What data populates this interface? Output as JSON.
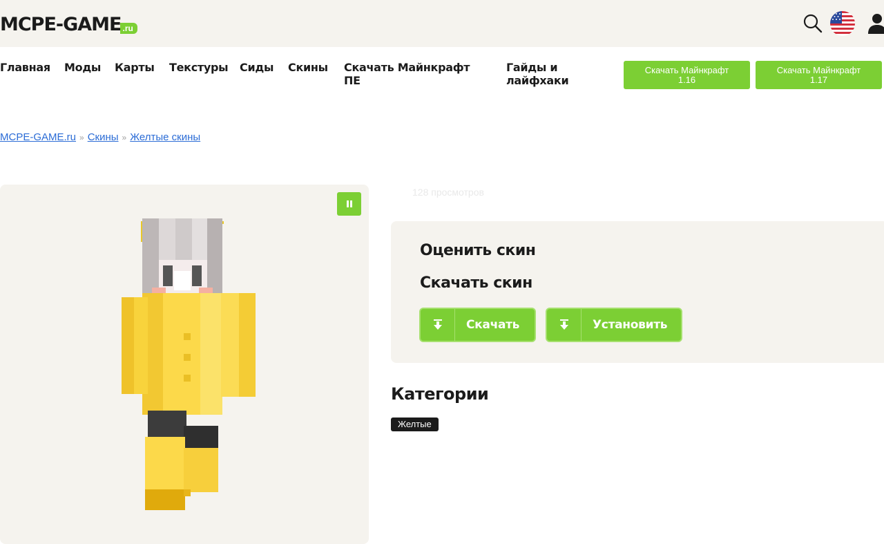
{
  "header": {
    "logo_main": "MCPE-GAME",
    "logo_suffix": ".ru",
    "icons": {
      "search": "search-icon",
      "language": "us-flag-icon",
      "account": "user-icon"
    }
  },
  "nav": {
    "items": [
      {
        "label": "Главная"
      },
      {
        "label": "Моды"
      },
      {
        "label": "Карты"
      },
      {
        "label": "Текстуры"
      },
      {
        "label": "Сиды"
      },
      {
        "label": "Скины"
      },
      {
        "label": "Скачать Майнкрафт ПЕ"
      },
      {
        "label": "Гайды и лайфхаки"
      }
    ],
    "download_buttons": [
      {
        "line1": "Скачать Майнкрафт",
        "line2": "1.16"
      },
      {
        "line1": "Скачать Майнкрафт",
        "line2": "1.17"
      }
    ]
  },
  "breadcrumb": {
    "items": [
      "MCPE-GAME.ru",
      "Скины",
      "Желтые скины"
    ],
    "separator": "»"
  },
  "skin": {
    "views": "128 просмотров",
    "rate_title": "Оценить скин",
    "download_title": "Скачать скин",
    "download_label": "Скачать",
    "install_label": "Установить"
  },
  "categories": {
    "title": "Категории",
    "tags": [
      "Желтые"
    ]
  },
  "colors": {
    "accent": "#7ccf34",
    "panel": "#f5f3ee",
    "link": "#2b6cd6",
    "text": "#1b1b1b"
  }
}
